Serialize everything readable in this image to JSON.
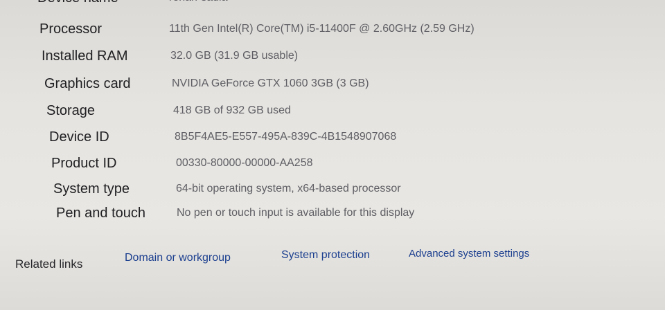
{
  "specs": {
    "device_name": {
      "label": "Device name",
      "value": "renan-sadia"
    },
    "processor": {
      "label": "Processor",
      "value": "11th Gen Intel(R) Core(TM) i5-11400F @ 2.60GHz (2.59 GHz)"
    },
    "installed_ram": {
      "label": "Installed RAM",
      "value": "32.0 GB (31.9 GB usable)"
    },
    "graphics_card": {
      "label": "Graphics card",
      "value": "NVIDIA GeForce GTX 1060 3GB (3 GB)"
    },
    "storage": {
      "label": "Storage",
      "value": "418 GB of 932 GB used"
    },
    "device_id": {
      "label": "Device ID",
      "value": "8B5F4AE5-E557-495A-839C-4B1548907068"
    },
    "product_id": {
      "label": "Product ID",
      "value": "00330-80000-00000-AA258"
    },
    "system_type": {
      "label": "System type",
      "value": "64-bit operating system, x64-based processor"
    },
    "pen_and_touch": {
      "label": "Pen and touch",
      "value": "No pen or touch input is available for this display"
    }
  },
  "related_links": {
    "title": "Related links",
    "domain": "Domain or workgroup",
    "protection": "System protection",
    "advanced": "Advanced system settings"
  }
}
